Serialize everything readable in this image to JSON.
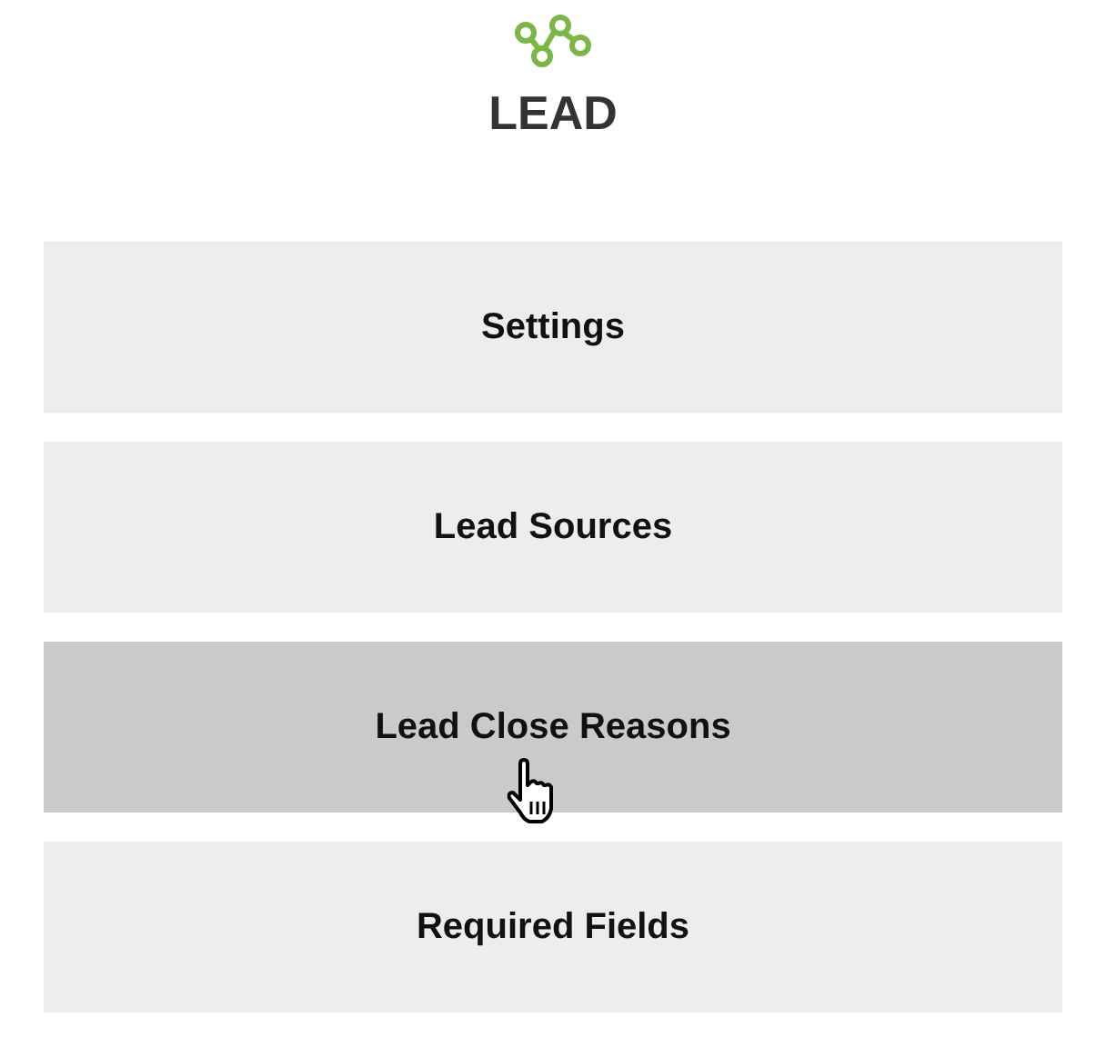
{
  "title": "LEAD",
  "menu": [
    {
      "label": "Settings",
      "hovered": false
    },
    {
      "label": "Lead Sources",
      "hovered": false
    },
    {
      "label": "Lead Close Reasons",
      "hovered": true
    },
    {
      "label": "Required Fields",
      "hovered": false
    }
  ]
}
